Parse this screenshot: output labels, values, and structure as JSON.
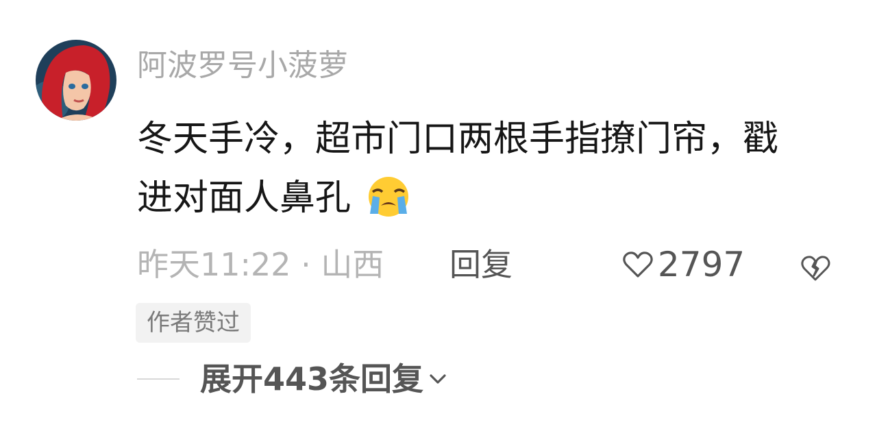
{
  "comment": {
    "username": "阿波罗号小菠萝",
    "text": "冬天手冷，超市门口两根手指撩门帘，戳进对面人鼻孔",
    "emoji": "loudly-crying-face",
    "time_location": "昨天11:22 · 山西",
    "reply_label": "回复",
    "like_icon": "heart-outline-icon",
    "like_count": "2797",
    "dislike_icon": "broken-heart-icon",
    "badge": "作者赞过",
    "expand_label": "展开443条回复",
    "colors": {
      "username": "#a8a8a8",
      "text": "#161616",
      "meta": "#b4b4b4",
      "action": "#555555",
      "badge_bg": "#f2f2f2"
    }
  }
}
